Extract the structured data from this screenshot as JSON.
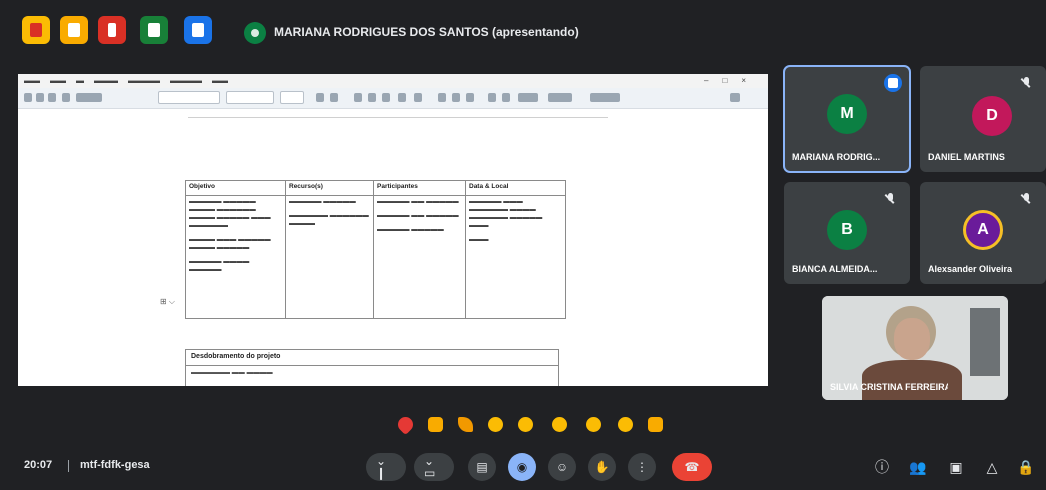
{
  "window": {
    "presenter_title": "MARIANA RODRIGUES DOS SANTOS (apresentando)"
  },
  "shared_screen": {
    "table_headers": [
      "Objetivo",
      "Recurso(s)",
      "Participantes",
      "Data & Local"
    ],
    "section2_heading": "Desdobramento do projeto"
  },
  "participants": [
    {
      "name": "MARIANA RODRIG...",
      "initial": "M",
      "color": "#0b8043",
      "speaking": true
    },
    {
      "name": "DANIEL MARTINS",
      "initial": "D",
      "color": "#c2185b",
      "muted": true
    },
    {
      "name": "BIANCA ALMEIDA...",
      "initial": "B",
      "color": "#0b8043",
      "muted": true
    },
    {
      "name": "Alexsander Oliveira",
      "initial": "A",
      "color": "#6a1b9a",
      "muted": true
    },
    {
      "name": "SILVIA CRISTINA FERREIRA",
      "camera": true
    }
  ],
  "meeting": {
    "time": "20:07",
    "code": "mtf-fdfk-gesa"
  },
  "colors": {
    "background": "#202124",
    "tile": "#3c4043",
    "end_call": "#ea4335",
    "active": "#8ab4f8"
  }
}
